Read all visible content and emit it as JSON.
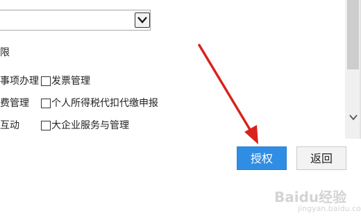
{
  "select": {
    "value": ""
  },
  "permissions": {
    "heading_partial": "限",
    "row1": {
      "left_partial": "事项办理",
      "right": "发票管理"
    },
    "row2": {
      "left_partial": "费管理",
      "right": "个人所得税代扣代缴申报"
    },
    "row3": {
      "left_partial": "互动",
      "right": "大企业服务与管理"
    }
  },
  "buttons": {
    "authorize": "授权",
    "back": "返回"
  },
  "watermark": {
    "brand": "Baidu经验",
    "sub": "jingyan.baidu.com"
  },
  "colors": {
    "primary": "#2f8de4",
    "annotation_arrow": "#d8231c"
  }
}
